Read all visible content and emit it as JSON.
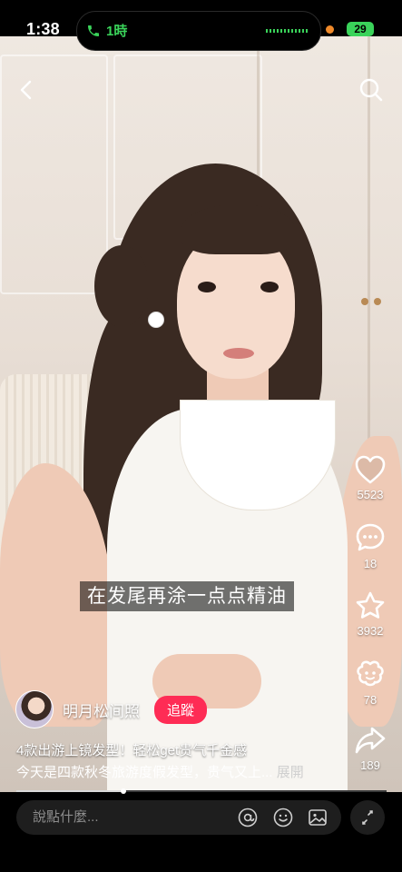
{
  "status_bar": {
    "time": "1:38",
    "call_label": "1時",
    "battery": "29"
  },
  "video": {
    "subtitle": "在发尾再涂一点点精油",
    "author": "明月松间照",
    "follow_label": "追蹤",
    "topic": "4款出游上镜发型！轻松get贵气千金感",
    "description": "今天是四款秋冬旅游度假发型，贵气又上...",
    "expand_label": "展開",
    "progress": 0.29
  },
  "actions": {
    "likes": "5523",
    "comments": "18",
    "favorites": "3932",
    "gifts": "78",
    "shares": "189"
  },
  "comment_bar": {
    "placeholder": "說點什麼..."
  },
  "icons": [
    "back-arrow-icon",
    "search-icon",
    "heart-icon",
    "comment-icon",
    "star-icon",
    "gift-icon",
    "share-icon",
    "at-icon",
    "emoji-icon",
    "image-icon",
    "expand-icon",
    "phone-icon"
  ]
}
